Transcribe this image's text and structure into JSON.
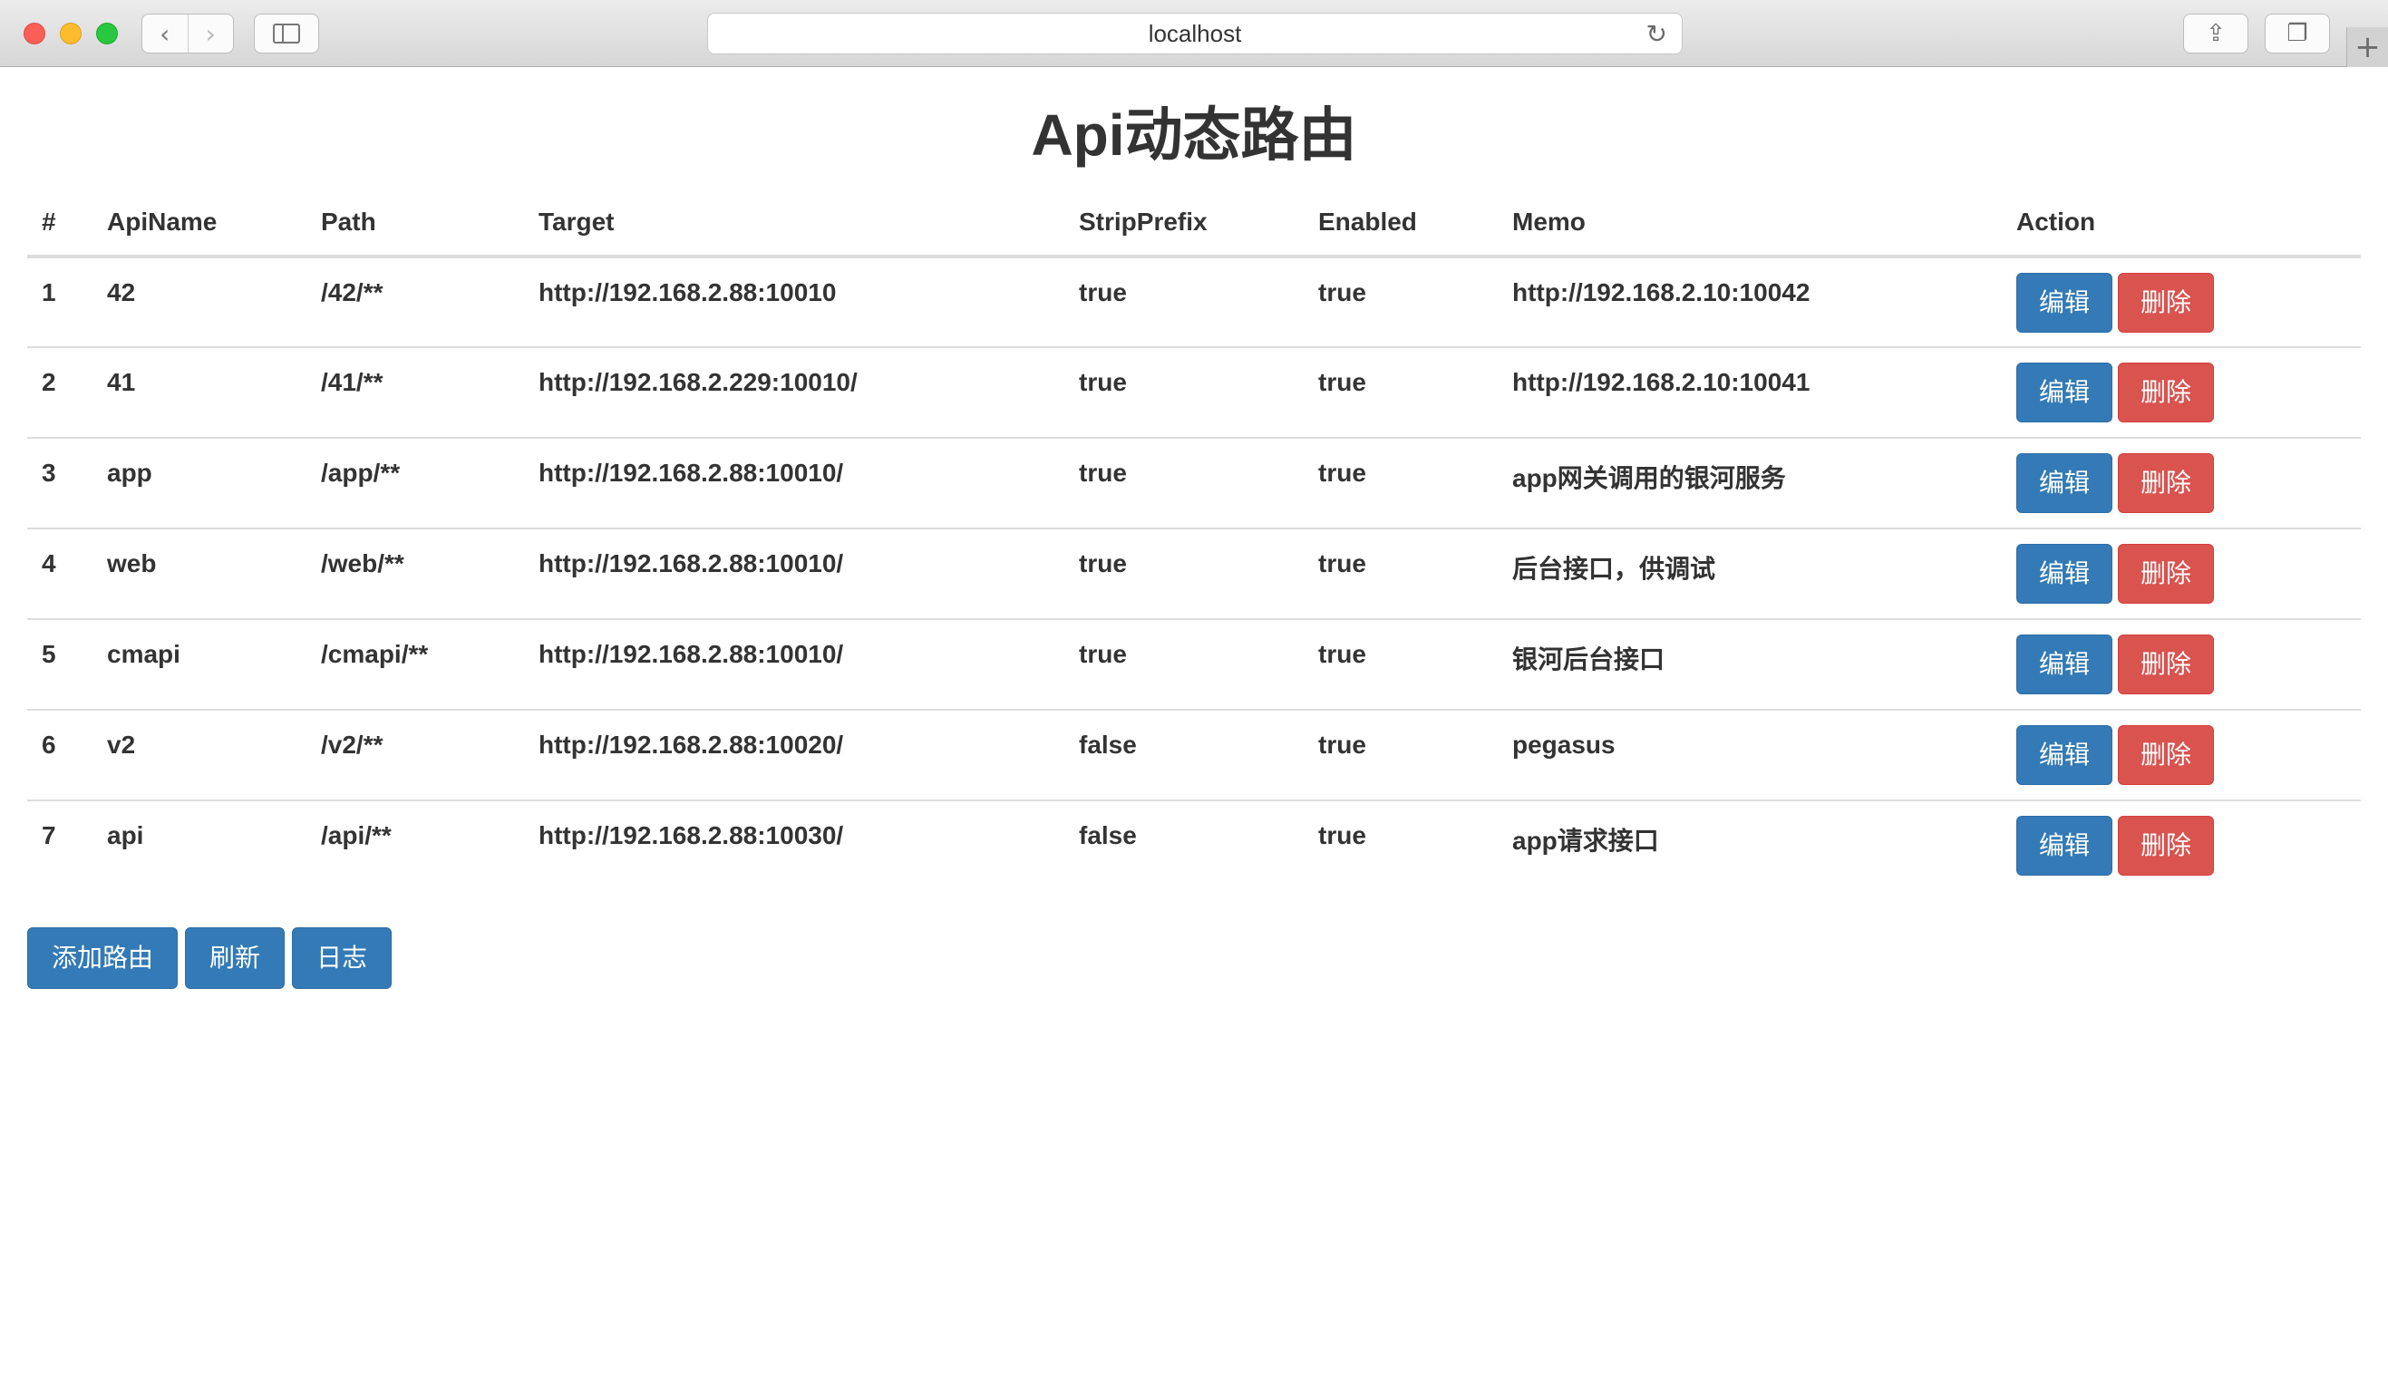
{
  "browser": {
    "url": "localhost",
    "back_icon": "chevron-left-icon",
    "forward_icon": "chevron-right-icon",
    "reload_icon": "reload-icon",
    "share_icon": "share-icon",
    "tabs_icon": "tabs-overview-icon",
    "new_tab_label": "+"
  },
  "page": {
    "title": "Api动态路由"
  },
  "table": {
    "headers": {
      "index": "#",
      "api_name": "ApiName",
      "path": "Path",
      "target": "Target",
      "strip_prefix": "StripPrefix",
      "enabled": "Enabled",
      "memo": "Memo",
      "action": "Action"
    },
    "rows": [
      {
        "index": "1",
        "api_name": "42",
        "path": "/42/**",
        "target": "http://192.168.2.88:10010",
        "strip_prefix": "true",
        "enabled": "true",
        "memo": "http://192.168.2.10:10042",
        "edit": "编辑",
        "delete": "删除"
      },
      {
        "index": "2",
        "api_name": "41",
        "path": "/41/**",
        "target": "http://192.168.2.229:10010/",
        "strip_prefix": "true",
        "enabled": "true",
        "memo": "http://192.168.2.10:10041",
        "edit": "编辑",
        "delete": "删除"
      },
      {
        "index": "3",
        "api_name": "app",
        "path": "/app/**",
        "target": "http://192.168.2.88:10010/",
        "strip_prefix": "true",
        "enabled": "true",
        "memo": "app网关调用的银河服务",
        "edit": "编辑",
        "delete": "删除"
      },
      {
        "index": "4",
        "api_name": "web",
        "path": "/web/**",
        "target": "http://192.168.2.88:10010/",
        "strip_prefix": "true",
        "enabled": "true",
        "memo": "后台接口，供调试",
        "edit": "编辑",
        "delete": "删除"
      },
      {
        "index": "5",
        "api_name": "cmapi",
        "path": "/cmapi/**",
        "target": "http://192.168.2.88:10010/",
        "strip_prefix": "true",
        "enabled": "true",
        "memo": "银河后台接口",
        "edit": "编辑",
        "delete": "删除"
      },
      {
        "index": "6",
        "api_name": "v2",
        "path": "/v2/**",
        "target": "http://192.168.2.88:10020/",
        "strip_prefix": "false",
        "enabled": "true",
        "memo": "pegasus",
        "edit": "编辑",
        "delete": "删除"
      },
      {
        "index": "7",
        "api_name": "api",
        "path": "/api/**",
        "target": "http://192.168.2.88:10030/",
        "strip_prefix": "false",
        "enabled": "true",
        "memo": "app请求接口",
        "edit": "编辑",
        "delete": "删除"
      }
    ]
  },
  "actions": {
    "add_route": "添加路由",
    "refresh": "刷新",
    "log": "日志"
  },
  "colors": {
    "primary": "#337ab7",
    "danger": "#d9534f"
  }
}
